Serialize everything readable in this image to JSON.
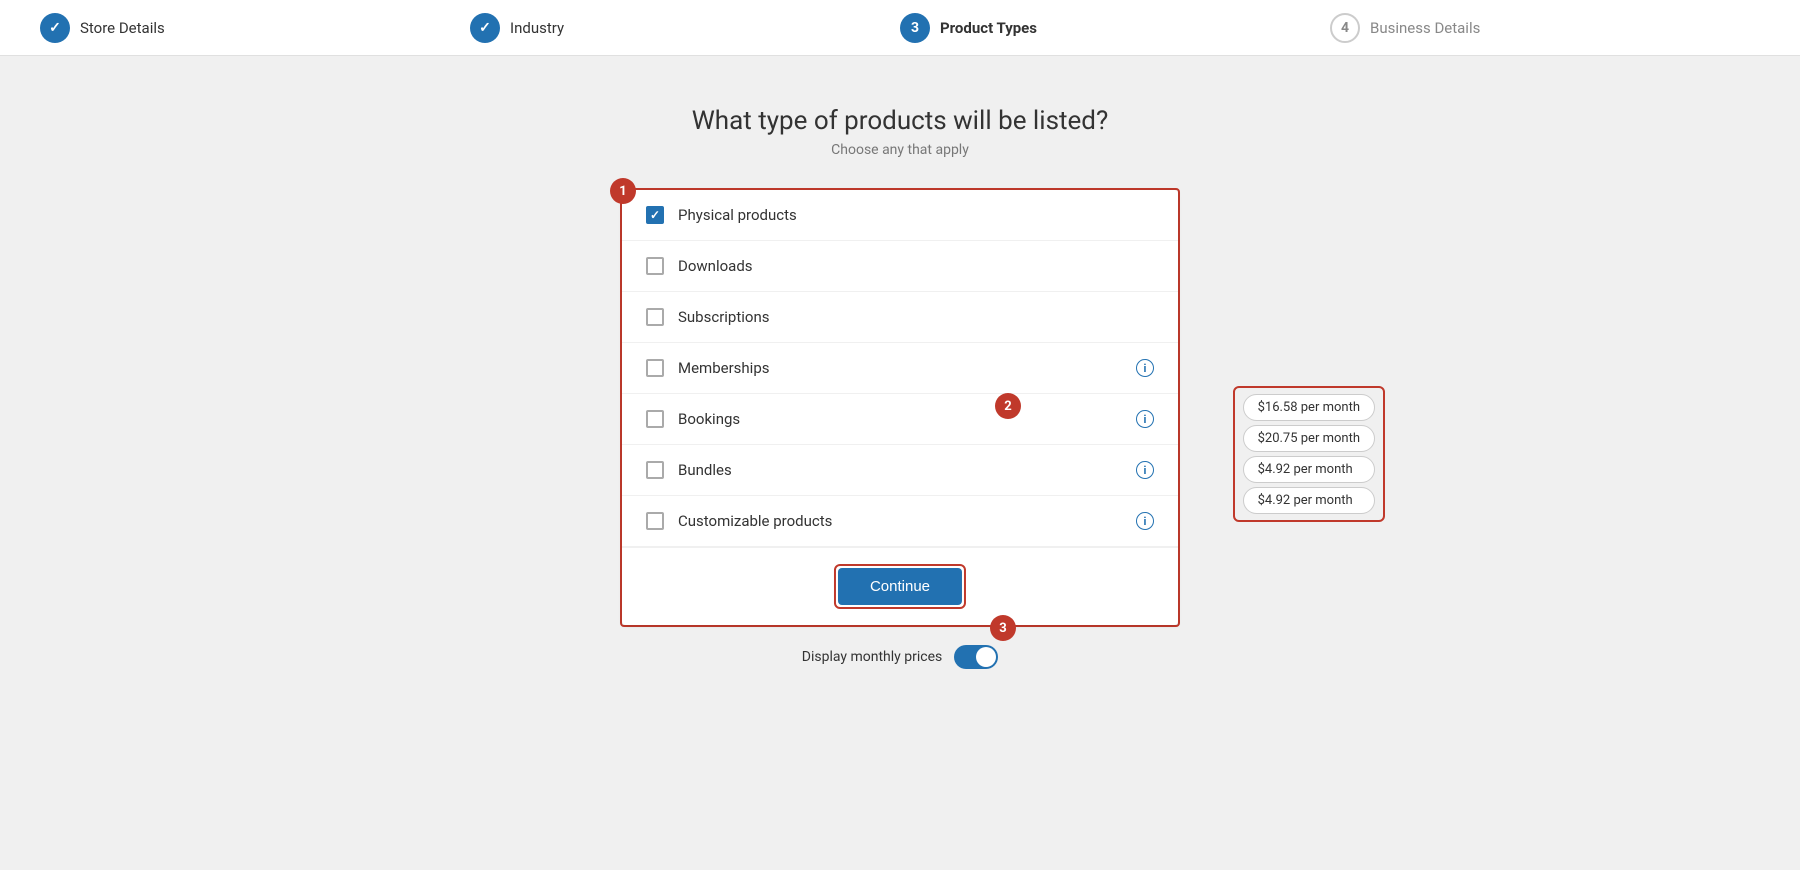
{
  "stepper": {
    "steps": [
      {
        "id": "store-details",
        "number": "✓",
        "label": "Store Details",
        "state": "completed"
      },
      {
        "id": "industry",
        "number": "✓",
        "label": "Industry",
        "state": "completed"
      },
      {
        "id": "product-types",
        "number": "3",
        "label": "Product Types",
        "state": "active"
      },
      {
        "id": "business-details",
        "number": "4",
        "label": "Business Details",
        "state": "inactive"
      }
    ]
  },
  "page": {
    "title": "What type of products will be listed?",
    "subtitle": "Choose any that apply"
  },
  "products": [
    {
      "id": "physical",
      "label": "Physical products",
      "checked": true,
      "hasInfo": false
    },
    {
      "id": "downloads",
      "label": "Downloads",
      "checked": false,
      "hasInfo": false
    },
    {
      "id": "subscriptions",
      "label": "Subscriptions",
      "checked": false,
      "hasInfo": false
    },
    {
      "id": "memberships",
      "label": "Memberships",
      "checked": false,
      "hasInfo": true
    },
    {
      "id": "bookings",
      "label": "Bookings",
      "checked": false,
      "hasInfo": true
    },
    {
      "id": "bundles",
      "label": "Bundles",
      "checked": false,
      "hasInfo": true
    },
    {
      "id": "customizable",
      "label": "Customizable products",
      "checked": false,
      "hasInfo": true
    }
  ],
  "prices": [
    {
      "id": "memberships-price",
      "value": "$16.58 per month"
    },
    {
      "id": "bookings-price",
      "value": "$20.75 per month"
    },
    {
      "id": "bundles-price",
      "value": "$4.92 per month"
    },
    {
      "id": "customizable-price",
      "value": "$4.92 per month"
    }
  ],
  "annotations": {
    "badge1": "1",
    "badge2": "2",
    "badge3": "3"
  },
  "buttons": {
    "continue": "Continue"
  },
  "footer": {
    "toggle_label": "Display monthly prices"
  }
}
